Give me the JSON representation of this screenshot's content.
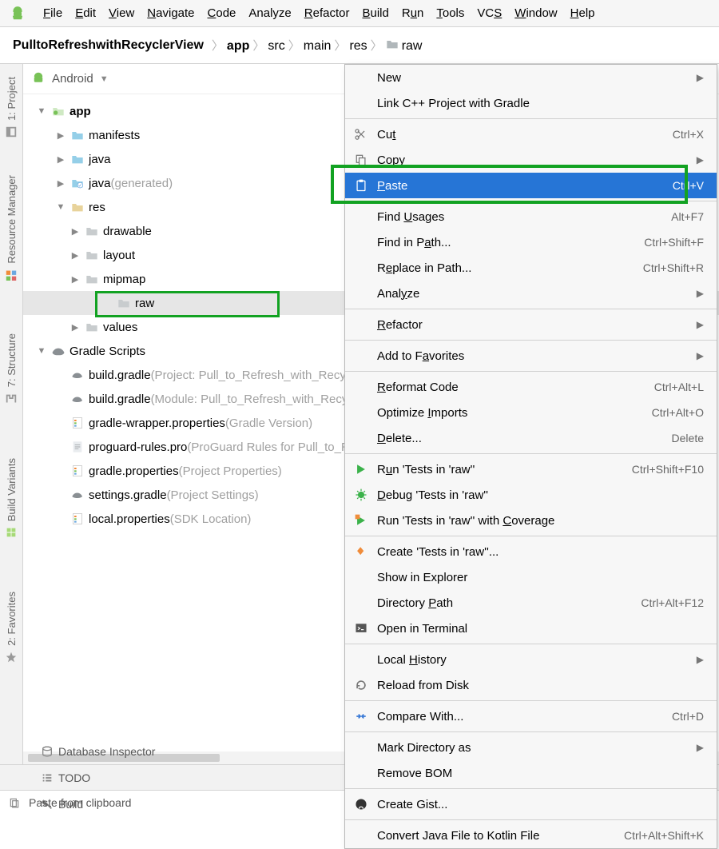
{
  "menubar": {
    "items": [
      {
        "label": "File",
        "u": 0
      },
      {
        "label": "Edit",
        "u": 0
      },
      {
        "label": "View",
        "u": 0
      },
      {
        "label": "Navigate",
        "u": 0
      },
      {
        "label": "Code",
        "u": 0
      },
      {
        "label": "Analyze",
        "u": -1
      },
      {
        "label": "Refactor",
        "u": 0
      },
      {
        "label": "Build",
        "u": 0
      },
      {
        "label": "Run",
        "u": 1
      },
      {
        "label": "Tools",
        "u": 0
      },
      {
        "label": "VCS",
        "u": 2
      },
      {
        "label": "Window",
        "u": 0
      },
      {
        "label": "Help",
        "u": 0
      }
    ]
  },
  "breadcrumbs": {
    "root": "PulltoRefreshwithRecyclerView",
    "items": [
      "app",
      "src",
      "main",
      "res",
      "raw"
    ],
    "bold_index": 0,
    "folder_icon_index": 4
  },
  "sideRail": [
    {
      "label": "1: Project",
      "active": true,
      "icon": "project"
    },
    {
      "label": "Resource Manager",
      "icon": "resource"
    },
    {
      "label": "7: Structure",
      "icon": "structure"
    },
    {
      "label": "Build Variants",
      "icon": "variants"
    },
    {
      "label": "2: Favorites",
      "icon": "favorites"
    }
  ],
  "panelHeader": {
    "mode": "Android"
  },
  "tree": [
    {
      "d": 1,
      "tw": "down",
      "icon": "module",
      "text": "app",
      "bold": true
    },
    {
      "d": 2,
      "tw": "right",
      "icon": "folder",
      "text": "manifests"
    },
    {
      "d": 2,
      "tw": "right",
      "icon": "folder",
      "text": "java"
    },
    {
      "d": 2,
      "tw": "right",
      "icon": "folder-gen",
      "text": "java",
      "fade": "(generated)"
    },
    {
      "d": 2,
      "tw": "down",
      "icon": "folder-res",
      "text": "res"
    },
    {
      "d": 3,
      "tw": "right",
      "icon": "folder-gray",
      "text": "drawable"
    },
    {
      "d": 3,
      "tw": "right",
      "icon": "folder-gray",
      "text": "layout"
    },
    {
      "d": 3,
      "tw": "right",
      "icon": "folder-gray",
      "text": "mipmap"
    },
    {
      "d": 4,
      "tw": "",
      "icon": "folder-gray",
      "text": "raw",
      "selected": true,
      "box": true
    },
    {
      "d": 3,
      "tw": "right",
      "icon": "folder-gray",
      "text": "values"
    },
    {
      "d": 1,
      "tw": "down",
      "icon": "gradle",
      "text": "Gradle Scripts"
    },
    {
      "d": 2,
      "tw": "",
      "icon": "gradle-file",
      "text": "build.gradle",
      "fade": "(Project: Pull_to_Refresh_with_RecyclerView)"
    },
    {
      "d": 2,
      "tw": "",
      "icon": "gradle-file",
      "text": "build.gradle",
      "fade": "(Module: Pull_to_Refresh_with_RecyclerView.app)"
    },
    {
      "d": 2,
      "tw": "",
      "icon": "props",
      "text": "gradle-wrapper.properties",
      "fade": "(Gradle Version)"
    },
    {
      "d": 2,
      "tw": "",
      "icon": "text",
      "text": "proguard-rules.pro",
      "fade": "(ProGuard Rules for Pull_to_Refresh_with_RecyclerView.app)"
    },
    {
      "d": 2,
      "tw": "",
      "icon": "props",
      "text": "gradle.properties",
      "fade": "(Project Properties)"
    },
    {
      "d": 2,
      "tw": "",
      "icon": "gradle-file",
      "text": "settings.gradle",
      "fade": "(Project Settings)"
    },
    {
      "d": 2,
      "tw": "",
      "icon": "props",
      "text": "local.properties",
      "fade": "(SDK Location)"
    }
  ],
  "contextMenu": [
    {
      "type": "item",
      "label": "New",
      "u": -1,
      "sub": true
    },
    {
      "type": "item",
      "label": "Link C++ Project with Gradle"
    },
    {
      "type": "sep"
    },
    {
      "type": "item",
      "icon": "cut",
      "label": "Cut",
      "u": 2,
      "shortcut": "Ctrl+X"
    },
    {
      "type": "item",
      "icon": "copy",
      "label": "Copy",
      "u": 0,
      "sub": true
    },
    {
      "type": "item",
      "icon": "paste",
      "label": "Paste",
      "u": 0,
      "shortcut": "Ctrl+V",
      "active": true,
      "box": true
    },
    {
      "type": "sep"
    },
    {
      "type": "item",
      "label": "Find Usages",
      "u": 5,
      "shortcut": "Alt+F7"
    },
    {
      "type": "item",
      "label": "Find in Path...",
      "u": 9,
      "shortcut": "Ctrl+Shift+F"
    },
    {
      "type": "item",
      "label": "Replace in Path...",
      "u": 1,
      "shortcut": "Ctrl+Shift+R"
    },
    {
      "type": "item",
      "label": "Analyze",
      "u": 4,
      "sub": true
    },
    {
      "type": "sep"
    },
    {
      "type": "item",
      "label": "Refactor",
      "u": 0,
      "sub": true
    },
    {
      "type": "sep"
    },
    {
      "type": "item",
      "label": "Add to Favorites",
      "u": 8,
      "sub": true
    },
    {
      "type": "sep"
    },
    {
      "type": "item",
      "label": "Reformat Code",
      "u": 0,
      "shortcut": "Ctrl+Alt+L"
    },
    {
      "type": "item",
      "label": "Optimize Imports",
      "u": 9,
      "shortcut": "Ctrl+Alt+O"
    },
    {
      "type": "item",
      "label": "Delete...",
      "u": 0,
      "shortcut": "Delete"
    },
    {
      "type": "sep"
    },
    {
      "type": "item",
      "icon": "run",
      "label": "Run 'Tests in 'raw''",
      "u": 1,
      "shortcut": "Ctrl+Shift+F10"
    },
    {
      "type": "item",
      "icon": "debug",
      "label": "Debug 'Tests in 'raw''",
      "u": 0
    },
    {
      "type": "item",
      "icon": "coverage",
      "label": "Run 'Tests in 'raw'' with Coverage",
      "u": 26
    },
    {
      "type": "sep"
    },
    {
      "type": "item",
      "icon": "create",
      "label": "Create 'Tests in 'raw''..."
    },
    {
      "type": "item",
      "label": "Show in Explorer"
    },
    {
      "type": "item",
      "label": "Directory Path",
      "u": 10,
      "shortcut": "Ctrl+Alt+F12"
    },
    {
      "type": "item",
      "icon": "terminal",
      "label": "Open in Terminal"
    },
    {
      "type": "sep"
    },
    {
      "type": "item",
      "label": "Local History",
      "u": 6,
      "sub": true
    },
    {
      "type": "item",
      "icon": "reload",
      "label": "Reload from Disk"
    },
    {
      "type": "sep"
    },
    {
      "type": "item",
      "icon": "compare",
      "label": "Compare With...",
      "shortcut": "Ctrl+D"
    },
    {
      "type": "sep"
    },
    {
      "type": "item",
      "label": "Mark Directory as",
      "sub": true
    },
    {
      "type": "item",
      "label": "Remove BOM"
    },
    {
      "type": "sep"
    },
    {
      "type": "item",
      "icon": "github",
      "label": "Create Gist..."
    },
    {
      "type": "sep"
    },
    {
      "type": "item",
      "label": "Convert Java File to Kotlin File",
      "shortcut": "Ctrl+Alt+Shift+K"
    }
  ],
  "toolstrip": [
    {
      "icon": "db",
      "label": "Database Inspector"
    },
    {
      "icon": "todo",
      "label": "TODO"
    },
    {
      "icon": "hammer",
      "label": "Build"
    }
  ],
  "statusbar": {
    "text": "Paste from clipboard"
  }
}
